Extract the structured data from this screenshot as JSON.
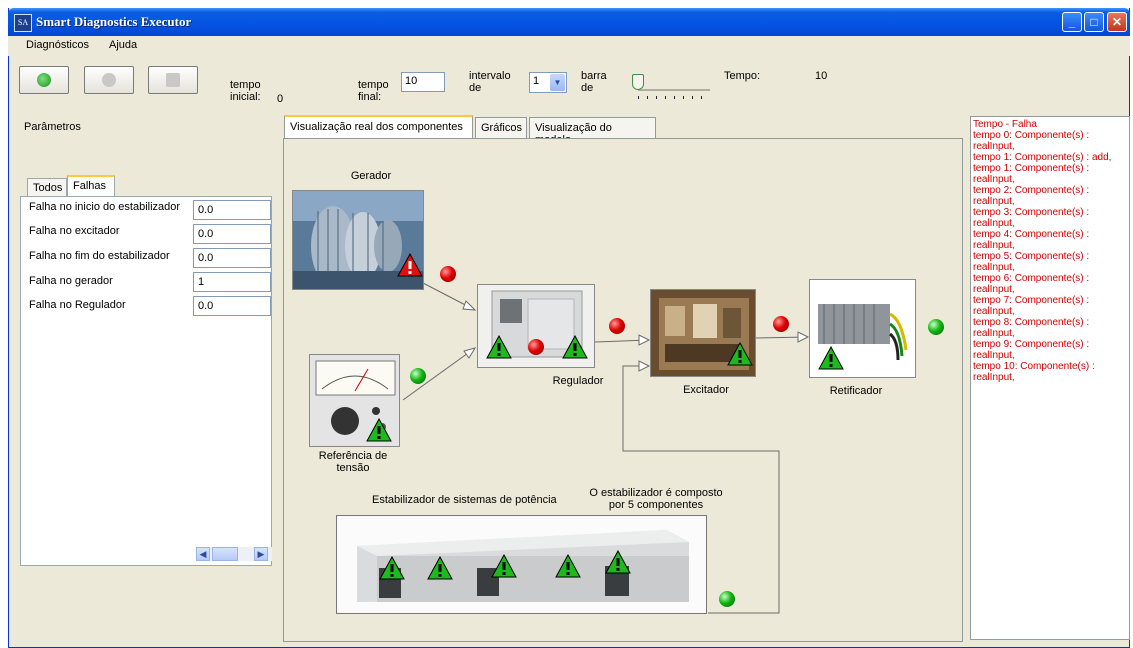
{
  "window": {
    "title": "Smart Diagnostics Executor",
    "icon_text": "SA"
  },
  "menu": [
    "Diagnósticos",
    "Ajuda"
  ],
  "toolbar": {
    "play": "play-icon",
    "pause": "pause-icon",
    "stop": "stop-icon"
  },
  "controls": {
    "tempo_inicial_label": [
      "tempo",
      "inicial:"
    ],
    "tempo_inicial_value": "0",
    "tempo_final_label": [
      "tempo",
      "final:"
    ],
    "tempo_final_value": "10",
    "intervalo_label": [
      "intervalo",
      "de"
    ],
    "intervalo_value": "1",
    "barra_label": [
      "barra",
      "de"
    ],
    "barra_level": 0,
    "tempo_label": "Tempo:",
    "tempo_value": "10"
  },
  "left": {
    "title": "Parâmetros",
    "tabs": [
      "Todos",
      "Falhas"
    ],
    "params": [
      {
        "label": "Falha no inicio do estabilizador",
        "value": "0.0"
      },
      {
        "label": "Falha no excitador",
        "value": "0.0"
      },
      {
        "label": "Falha no fim do estabilizador",
        "value": "0.0"
      },
      {
        "label": "Falha no gerador",
        "value": "1"
      },
      {
        "label": "Falha no Regulador",
        "value": "0.0"
      }
    ]
  },
  "center": {
    "tabs": [
      "Visualização real dos componentes",
      "Gráficos",
      "Visualização do modelo"
    ],
    "components": {
      "gerador": "Gerador",
      "referencia": [
        "Referência de",
        "tensão"
      ],
      "regulador": "Regulador",
      "excitador": "Excitador",
      "retificador": "Retificador",
      "estabilizador": "Estabilizador de sistemas de potência",
      "estabilizador_note": [
        "O estabilizador é composto",
        "por 5 componentes"
      ]
    },
    "colors": {
      "led_red": "#e00000",
      "led_green": "#12b512",
      "warn_red": "#e01010",
      "warn_green": "#1db91d"
    }
  },
  "log": [
    "Tempo - Falha",
    "tempo 0: Componente(s) : realInput,",
    "tempo 1: Componente(s) : add,",
    "tempo 1: Componente(s) : realInput,",
    "tempo 2: Componente(s) : realInput,",
    "tempo 3: Componente(s) : realInput,",
    "tempo 4: Componente(s) : realInput,",
    "tempo 5: Componente(s) : realInput,",
    "tempo 6: Componente(s) : realInput,",
    "tempo 7: Componente(s) : realInput,",
    "tempo 8: Componente(s) : realInput,",
    "tempo 9: Componente(s) : realInput,",
    "tempo 10: Componente(s) : realInput,"
  ]
}
